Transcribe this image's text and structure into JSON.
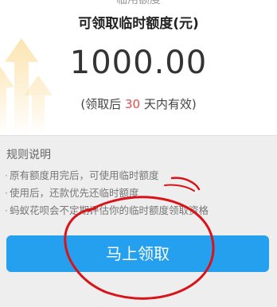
{
  "header": {
    "cut_title": "临用额度",
    "title": "可领取临时额度(元)",
    "amount": "1000.00",
    "valid_prefix": "(领取后 ",
    "valid_days": "30",
    "valid_suffix": " 天内有效)"
  },
  "rules": {
    "title": "规则说明",
    "items": [
      "原有额度用完后，可使用临时额度",
      "使用后，还款优先还临时额度",
      "蚂蚁花呗会不定期评估你的临时额度领取资格"
    ]
  },
  "action": {
    "claim_label": "马上领取"
  },
  "colors": {
    "accent": "#25a0ee",
    "highlight": "#e8494a",
    "annotation": "#d8141a"
  },
  "icons": [
    "up-arrows-decoration-icon"
  ]
}
